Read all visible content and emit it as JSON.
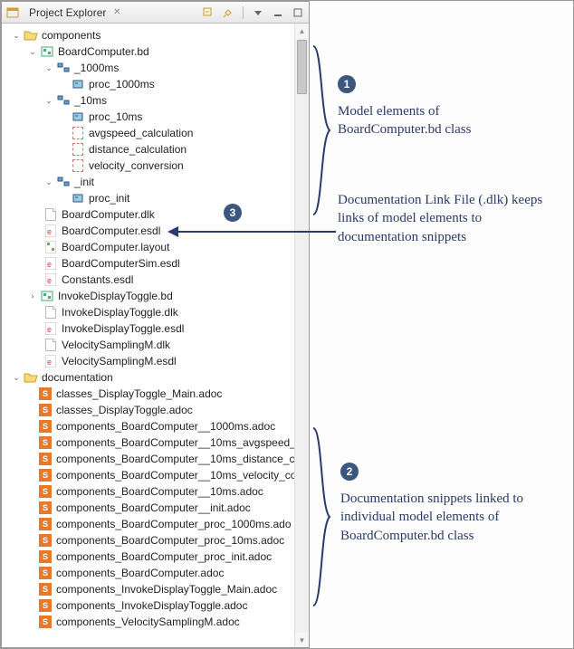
{
  "view": {
    "title": "Project Explorer"
  },
  "tree": {
    "components": {
      "label": "components",
      "boardcomputer_bd": {
        "label": "BoardComputer.bd",
        "p1000ms": {
          "label": "_1000ms",
          "proc": "proc_1000ms"
        },
        "p10ms": {
          "label": "_10ms",
          "proc": "proc_10ms",
          "f1": "avgspeed_calculation",
          "f2": "distance_calculation",
          "f3": "velocity_conversion"
        },
        "pinit": {
          "label": "_init",
          "proc": "proc_init"
        }
      },
      "files": {
        "f0": "BoardComputer.dlk",
        "f1": "BoardComputer.esdl",
        "f2": "BoardComputer.layout",
        "f3": "BoardComputerSim.esdl",
        "f4": "Constants.esdl",
        "f5": "InvokeDisplayToggle.bd",
        "f6": "InvokeDisplayToggle.dlk",
        "f7": "InvokeDisplayToggle.esdl",
        "f8": "VelocitySamplingM.dlk",
        "f9": "VelocitySamplingM.esdl"
      }
    },
    "documentation": {
      "label": "documentation",
      "d0": "classes_DisplayToggle_Main.adoc",
      "d1": "classes_DisplayToggle.adoc",
      "d2": "components_BoardComputer__1000ms.adoc",
      "d3": "components_BoardComputer__10ms_avgspeed_",
      "d4": "components_BoardComputer__10ms_distance_c",
      "d5": "components_BoardComputer__10ms_velocity_co",
      "d6": "components_BoardComputer__10ms.adoc",
      "d7": "components_BoardComputer__init.adoc",
      "d8": "components_BoardComputer_proc_1000ms.ado",
      "d9": "components_BoardComputer_proc_10ms.adoc",
      "d10": "components_BoardComputer_proc_init.adoc",
      "d11": "components_BoardComputer.adoc",
      "d12": "components_InvokeDisplayToggle_Main.adoc",
      "d13": "components_InvokeDisplayToggle.adoc",
      "d14": "components_VelocitySamplingM.adoc"
    }
  },
  "callouts": {
    "n1": "1",
    "n2": "2",
    "n3": "3",
    "t1": "Model elements of BoardComputer.bd class",
    "t2": "Documentation snippets linked to individual model elements of BoardComputer.bd class",
    "t3": "Documentation Link File (.dlk) keeps links of model elements to documentation snippets"
  }
}
